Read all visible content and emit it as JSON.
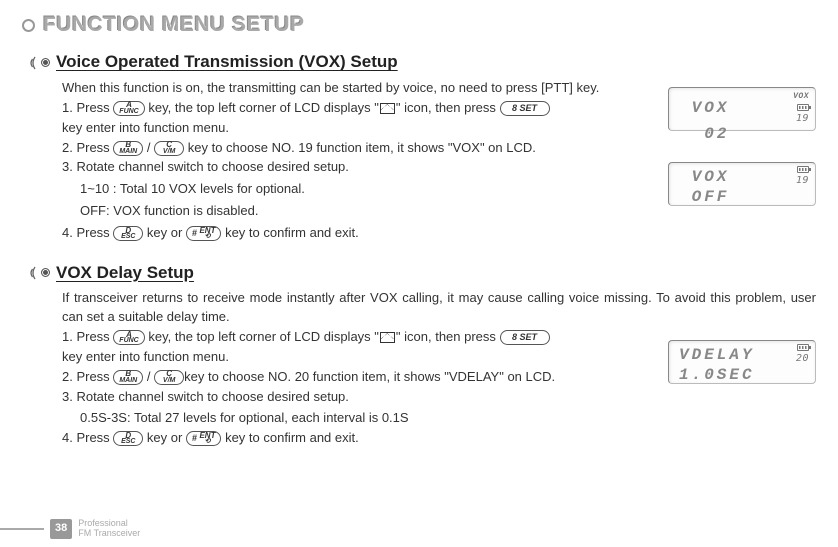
{
  "page_title": "FUNCTION MENU SETUP",
  "sections": [
    {
      "heading": "Voice Operated Transmission (VOX) Setup",
      "intro": "When this function is on, the transmitting can be started by voice, no need to press [PTT] key.",
      "steps": {
        "s1a": "1. Press ",
        "s1b": " key, the top left corner of LCD displays \"",
        "s1c": "\" icon, then press ",
        "s1d": "key enter into function menu.",
        "s2a": "2. Press ",
        "s2b": " / ",
        "s2c": " key to choose NO. 19 function item, it shows \"VOX\" on LCD.",
        "s3": "3. Rotate channel switch to choose desired setup.",
        "s3a": "1~10 : Total 10 VOX levels for optional.",
        "s3b": "OFF: VOX function is disabled.",
        "s4a": "4. Press ",
        "s4b": " key or ",
        "s4c": " key to confirm and exit."
      }
    },
    {
      "heading": "VOX Delay Setup",
      "intro": "If transceiver returns to receive mode instantly after VOX calling, it may cause calling voice missing. To avoid this problem, user can set a suitable delay time.",
      "steps": {
        "s1a": "1. Press ",
        "s1b": " key, the top left corner of LCD displays \"",
        "s1c": "\" icon, then press ",
        "s1d": " key enter into function menu.",
        "s2a": "2. Press ",
        "s2b": " / ",
        "s2c": "key to choose NO. 20 function item, it shows \"VDELAY\" on LCD.",
        "s3": "3. Rotate channel switch to choose desired setup.",
        "s3a": "0.5S-3S: Total 27 levels for optional, each interval is 0.1S",
        "s4a": "4. Press ",
        "s4b": " key or ",
        "s4c": " key to confirm and exit."
      }
    }
  ],
  "keys": {
    "a_func": {
      "top": "A",
      "bot": "FUNC"
    },
    "b_main": {
      "top": "B",
      "bot": "MAIN"
    },
    "c_vm": {
      "top": "C",
      "bot": "V/M"
    },
    "d_esc": {
      "top": "D",
      "bot": "ESC"
    },
    "hash_ent": {
      "left": "#",
      "top": "ENT",
      "bot": "⟲"
    },
    "8_set": {
      "label": "8 SET"
    }
  },
  "lcd": {
    "vox_on": {
      "annun": "VOX",
      "ch": "19",
      "line1": " VOX",
      "line2": "  02"
    },
    "vox_off": {
      "ch": "19",
      "line1": " VOX",
      "line2": " OFF"
    },
    "vdelay": {
      "ch": "20",
      "line1": "VDELAY",
      "line2": "1.0SEC"
    }
  },
  "footer": {
    "page": "38",
    "line1": "Professional",
    "line2": "FM Transceiver"
  }
}
